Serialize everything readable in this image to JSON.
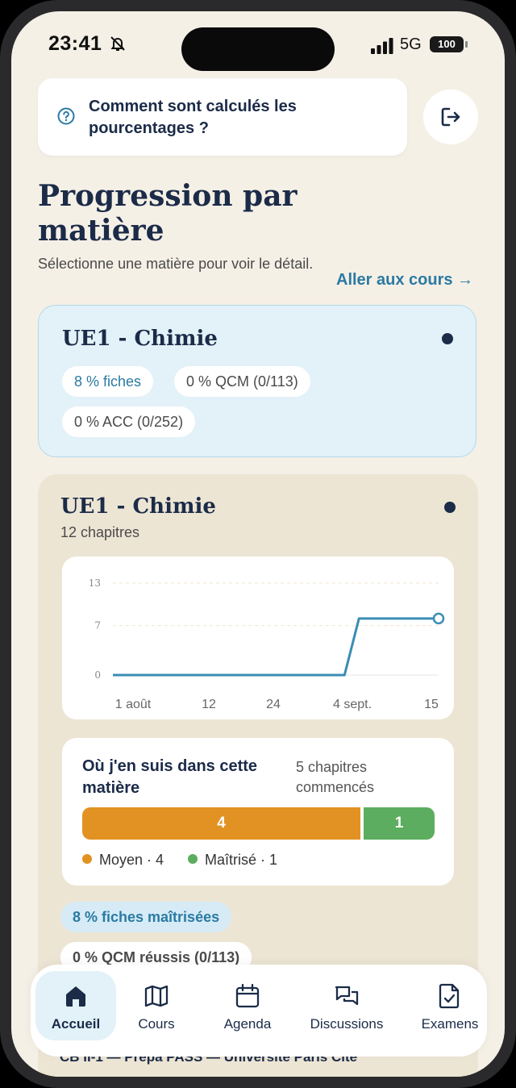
{
  "status_bar": {
    "time": "23:41",
    "network": "5G",
    "battery": "100"
  },
  "help": {
    "label": "Comment sont calculés les pourcentages ?"
  },
  "header": {
    "title": "Progression par matière",
    "subtitle": "Sélectionne une matière pour voir le détail.",
    "courses_link": "Aller aux cours →"
  },
  "subject_card": {
    "title": "UE1 - Chimie",
    "pills": [
      "8 % fiches",
      "0 % QCM (0/113)",
      "0 % ACC (0/252)"
    ]
  },
  "detail_card": {
    "title": "UE1 - Chimie",
    "chapters": "12 chapitres",
    "progress": {
      "title": "Où j'en suis dans cette matière",
      "count": "5 chapitres commencés",
      "segments": [
        {
          "label": "4",
          "value": 4,
          "color": "#e29222"
        },
        {
          "label": "1",
          "value": 1,
          "color": "#5cad5f"
        }
      ],
      "legend": [
        {
          "label": "Moyen · 4",
          "color": "#e29222"
        },
        {
          "label": "Maîtrisé · 1",
          "color": "#5cad5f"
        }
      ]
    },
    "pills": [
      "8 % fiches maîtrisées",
      "0 % QCM réussis (0/113)"
    ],
    "footer_text": "CB II-1 — Prépa PASS — Université Paris Cité"
  },
  "chart_data": {
    "type": "line",
    "x_ticks": [
      "1 août",
      "12",
      "24",
      "4 sept.",
      "15"
    ],
    "y_ticks": [
      "0",
      "7",
      "13"
    ],
    "ylim": [
      0,
      13
    ],
    "series": [
      {
        "color": "#3a8db5",
        "points": [
          {
            "x": "1 août",
            "y": 0
          },
          {
            "x": "2 sept.",
            "y": 0
          },
          {
            "x": "4 sept.",
            "y": 8
          },
          {
            "x": "15 sept.",
            "y": 8
          }
        ]
      }
    ],
    "grid": true
  },
  "nav": {
    "items": [
      {
        "label": "Accueil",
        "icon": "home-icon",
        "active": true
      },
      {
        "label": "Cours",
        "icon": "map-icon",
        "active": false
      },
      {
        "label": "Agenda",
        "icon": "calendar-icon",
        "active": false
      },
      {
        "label": "Discussions",
        "icon": "chat-icon",
        "active": false
      },
      {
        "label": "Examens",
        "icon": "exam-icon",
        "active": false
      }
    ]
  },
  "colors": {
    "navy": "#1b2b48",
    "accent": "#2b7aa3",
    "beige": "#f5f0e6",
    "card_blue": "#e3f1f8"
  }
}
